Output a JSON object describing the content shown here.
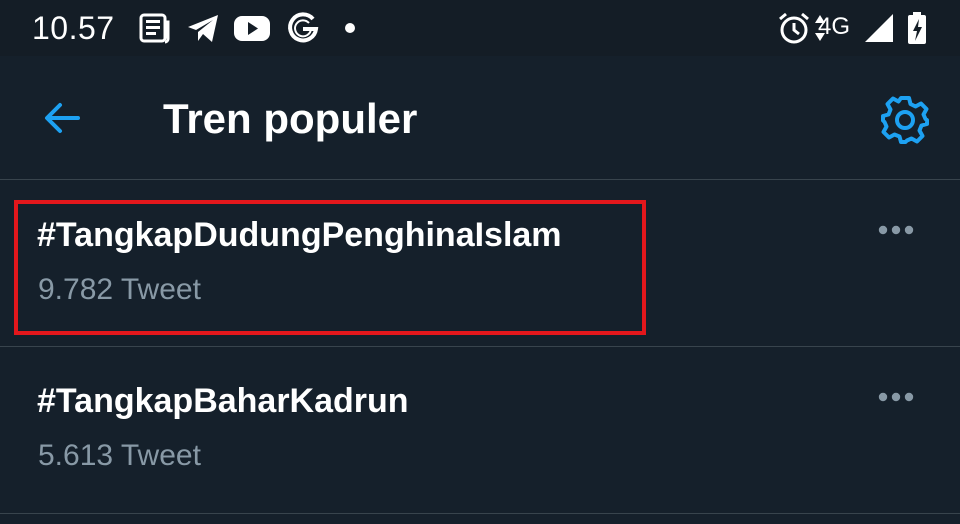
{
  "status_bar": {
    "time": "10.57",
    "network": "4G",
    "icons": [
      "news-icon",
      "telegram-icon",
      "youtube-icon",
      "google-icon",
      "notification-dot-icon",
      "alarm-icon",
      "data-arrows-icon",
      "signal-icon",
      "battery-icon"
    ]
  },
  "header": {
    "back_icon": "arrow-left-icon",
    "title": "Tren populer",
    "settings_icon": "gear-icon"
  },
  "trends": [
    {
      "name": "#TangkapDudungPenghinaIslam",
      "count": "9.782 Tweet",
      "more_icon": "more-horizontal-icon",
      "highlighted": true
    },
    {
      "name": "#TangkapBaharKadrun",
      "count": "5.613 Tweet",
      "more_icon": "more-horizontal-icon",
      "highlighted": false
    }
  ],
  "colors": {
    "background": "#15202b",
    "status_bar": "#141d26",
    "accent": "#1da1f2",
    "divider": "#38444d",
    "secondary_text": "#8899a6",
    "highlight": "#e3171c"
  }
}
